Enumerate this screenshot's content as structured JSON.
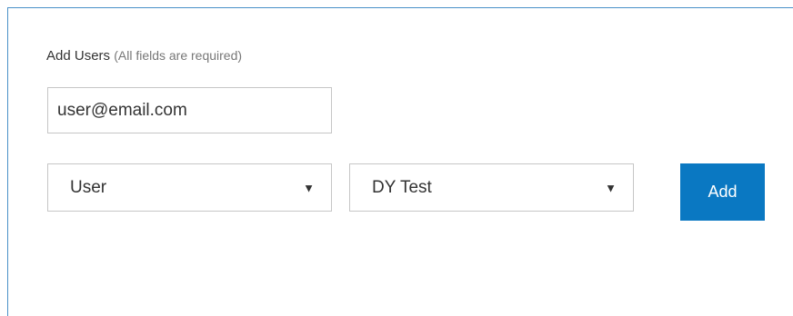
{
  "form": {
    "title": "Add Users",
    "note": "(All fields are required)",
    "email_value": "user@email.com",
    "role_value": "User",
    "group_value": "DY Test",
    "caret_glyph": "▼",
    "add_label": "Add"
  },
  "colors": {
    "border_accent": "#4a90c8",
    "button_bg": "#0a78c2",
    "button_text": "#ffffff"
  }
}
